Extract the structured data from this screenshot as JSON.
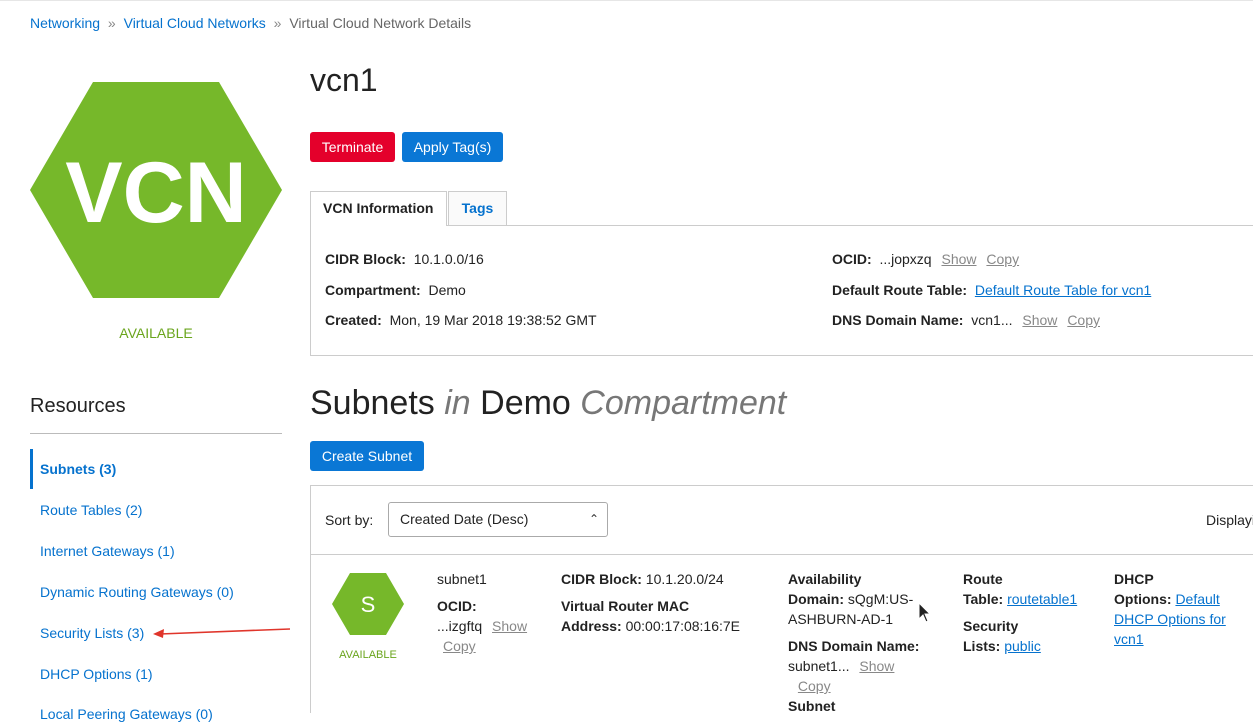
{
  "breadcrumb": {
    "items": [
      "Networking",
      "Virtual Cloud Networks"
    ],
    "separator": "»",
    "current": "Virtual Cloud Network Details"
  },
  "vcn": {
    "icon_text": "VCN",
    "icon_color": "#76b82a",
    "state": "AVAILABLE",
    "name": "vcn1"
  },
  "actions": {
    "terminate": "Terminate",
    "apply_tags": "Apply Tag(s)"
  },
  "tabs": [
    {
      "label": "VCN Information",
      "active": true
    },
    {
      "label": "Tags",
      "active": false
    }
  ],
  "info": {
    "cidr_label": "CIDR Block:",
    "cidr_value": "10.1.0.0/16",
    "compartment_label": "Compartment:",
    "compartment_value": "Demo",
    "created_label": "Created:",
    "created_value": "Mon, 19 Mar 2018 19:38:52 GMT",
    "ocid_label": "OCID:",
    "ocid_value": "...jopxzq",
    "show": "Show",
    "copy": "Copy",
    "route_label": "Default Route Table:",
    "route_value": "Default Route Table for vcn1",
    "dns_label": "DNS Domain Name:",
    "dns_value": "vcn1..."
  },
  "resources": {
    "heading": "Resources",
    "items": [
      {
        "label": "Subnets (3)",
        "active": true
      },
      {
        "label": "Route Tables (2)"
      },
      {
        "label": "Internet Gateways (1)"
      },
      {
        "label": "Dynamic Routing Gateways (0)"
      },
      {
        "label": "Security Lists (3)"
      },
      {
        "label": "DHCP Options (1)"
      },
      {
        "label": "Local Peering Gateways (0)"
      }
    ]
  },
  "subnets": {
    "heading_main": "Subnets",
    "heading_in": "in",
    "heading_comp": "Demo",
    "heading_suffix": "Compartment",
    "create_button": "Create Subnet",
    "sort_label": "Sort by:",
    "sort_value": "Created Date (Desc)",
    "display_label": "Displaying",
    "row": {
      "icon_letter": "S",
      "state": "AVAILABLE",
      "name": "subnet1",
      "ocid_label": "OCID:",
      "ocid_value": "...izgftq",
      "show": "Show",
      "copy": "Copy",
      "cidr_label": "CIDR Block:",
      "cidr_value": "10.1.20.0/24",
      "vrmac_label1": "Virtual Router MAC",
      "vrmac_label2": "Address:",
      "vrmac_value": "00:00:17:08:16:7E",
      "ad_label1": "Availability",
      "ad_label2": "Domain:",
      "ad_value1": "sQgM:US-",
      "ad_value2": "ASHBURN-AD-1",
      "dns_label": "DNS Domain Name:",
      "dns_value": "subnet1...",
      "subnet_label": "Subnet",
      "rt_label1": "Route",
      "rt_label2": "Table:",
      "rt_value": "routetable1",
      "sl_label1": "Security",
      "sl_label2": "Lists:",
      "sl_value": "public",
      "dhcp_label1": "DHCP",
      "dhcp_label2": "Options:",
      "dhcp_value1": "Default",
      "dhcp_value2": "DHCP Options for",
      "dhcp_value3": "vcn1"
    }
  },
  "annotation_arrow_color": "#e0352b"
}
